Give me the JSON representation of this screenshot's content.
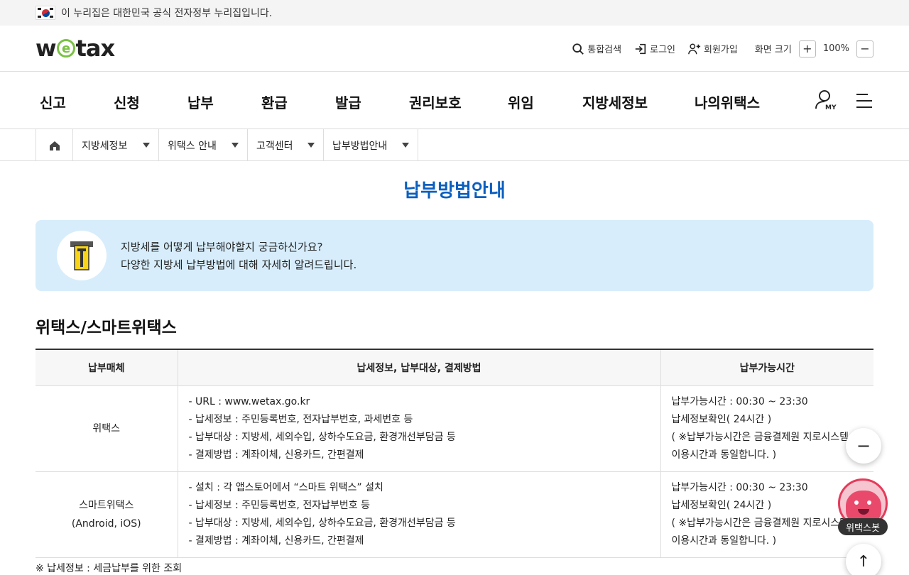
{
  "gov_banner": {
    "text": "이 누리집은 대한민국 공식 전자정부 누리집입니다."
  },
  "header": {
    "logo_text": "wetax",
    "utility": {
      "search_label": "통합검색",
      "login_label": "로그인",
      "signup_label": "회원가입",
      "zoom_label": "화면 크기",
      "zoom_in": "+",
      "zoom_value": "100%",
      "zoom_out": "−"
    }
  },
  "gnb": {
    "items": [
      "신고",
      "신청",
      "납부",
      "환급",
      "발급",
      "권리보호",
      "위임",
      "지방세정보",
      "나의위택스"
    ],
    "my_label": "MY"
  },
  "breadcrumb": {
    "items": [
      {
        "label": "지방세정보"
      },
      {
        "label": "위택스 안내"
      },
      {
        "label": "고객센터"
      },
      {
        "label": "납부방법안내"
      }
    ]
  },
  "page": {
    "title": "납부방법안내",
    "info_line1": "지방세를 어떻게 납부해야할지 궁금하신가요?",
    "info_line2": "다양한 지방세 납부방법에 대해 자세히 알려드립니다.",
    "section_title": "위택스/스마트위택스",
    "table": {
      "headers": [
        "납부매체",
        "납세정보, 납부대상, 결제방법",
        "납부가능시간"
      ],
      "rows": [
        {
          "media_line1": "위택스",
          "media_line2": "",
          "details": [
            "URL : www.wetax.go.kr",
            "납세정보 : 주민등록번호, 전자납부번호, 과세번호 등",
            "납부대상 : 지방세, 세외수입, 상하수도요금, 환경개선부담금 등",
            "결제방법 : 계좌이체, 신용카드, 간편결제"
          ],
          "times": [
            "납부가능시간 : 00:30 ~ 23:30",
            "납세정보확인( 24시간 )",
            "( ※납부가능시간은 금융결제원 지로시스템",
            "이용시간과 동일합니다. )"
          ]
        },
        {
          "media_line1": "스마트위택스",
          "media_line2": "(Android, iOS)",
          "details": [
            "설치 : 각 앱스토어에서 “스마트 위택스” 설치",
            "납세정보 : 주민등록번호, 전자납부번호 등",
            "납부대상 : 지방세, 세외수입, 상하수도요금, 환경개선부담금 등",
            "결제방법 : 계좌이체, 신용카드, 간편결제"
          ],
          "times": [
            "납부가능시간 : 00:30 ~ 23:30",
            "납세정보확인( 24시간 )",
            "( ※납부가능시간은 금융결제원 지로시스템",
            "이용시간과 동일합니다. )"
          ]
        }
      ]
    },
    "note": "※  납세정보 : 세금납부를 위한 조회"
  },
  "floating": {
    "collapse_symbol": "−",
    "bot_label": "위택스봇",
    "top_symbol": "↑"
  },
  "colors": {
    "title_blue": "#0a5fbf",
    "info_bg": "#d7edfb",
    "logo_green": "#7ac143",
    "bot_pink": "#e94a6b"
  }
}
